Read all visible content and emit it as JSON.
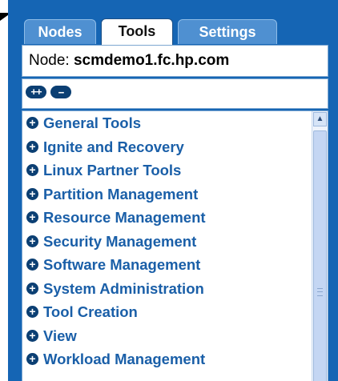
{
  "tabs": [
    {
      "label": "Nodes",
      "active": false
    },
    {
      "label": "Tools",
      "active": true
    },
    {
      "label": "Settings",
      "active": false
    }
  ],
  "node": {
    "label": "Node:",
    "value": "scmdemo1.fc.hp.com"
  },
  "tree_controls": {
    "expand_all": "++",
    "collapse_all": "--"
  },
  "tree": {
    "items": [
      {
        "label": "General Tools"
      },
      {
        "label": "Ignite and Recovery"
      },
      {
        "label": "Linux Partner Tools"
      },
      {
        "label": "Partition Management"
      },
      {
        "label": "Resource Management"
      },
      {
        "label": "Security Management"
      },
      {
        "label": "Software Management"
      },
      {
        "label": "System Administration"
      },
      {
        "label": "Tool Creation"
      },
      {
        "label": "View"
      },
      {
        "label": "Workload Management"
      }
    ]
  },
  "colors": {
    "panel": "#1565b4",
    "link": "#1a5fa8",
    "tab_inactive": "#4f90d1"
  }
}
